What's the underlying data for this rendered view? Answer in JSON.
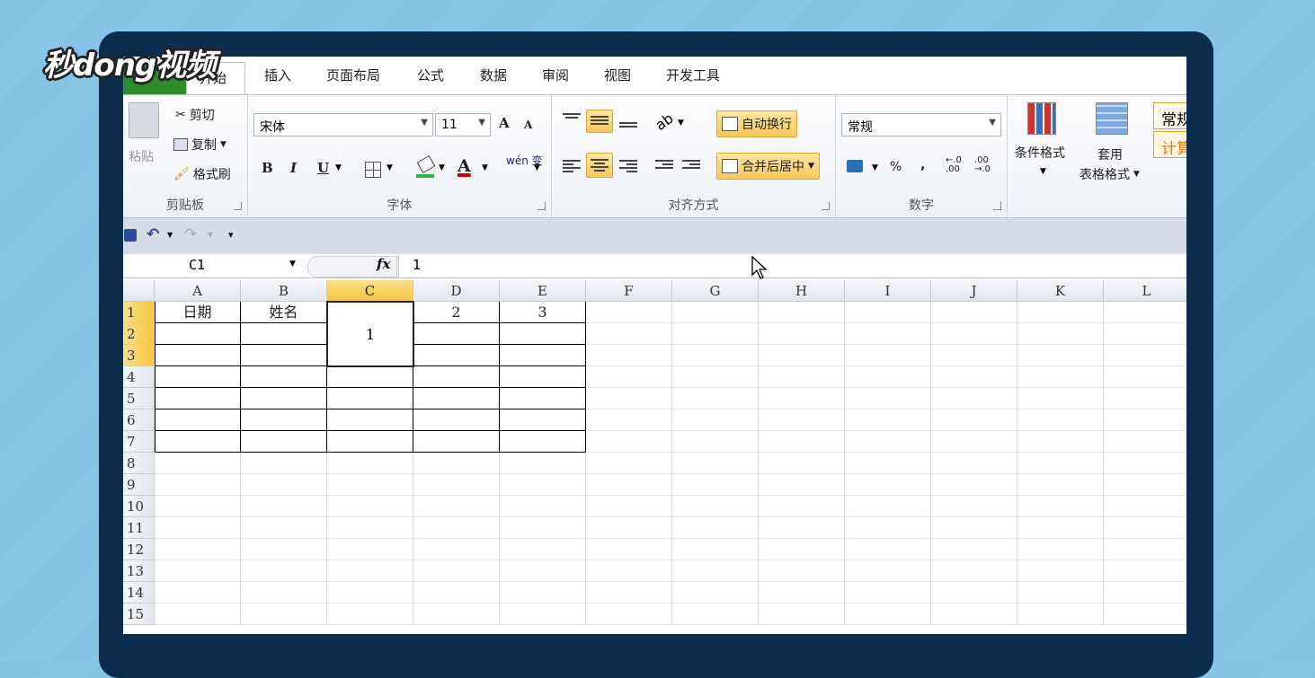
{
  "watermark": {
    "logo_text": "秒dong视频"
  },
  "tabs": [
    {
      "label": "开始",
      "active": true
    },
    {
      "label": "插入"
    },
    {
      "label": "页面布局"
    },
    {
      "label": "公式"
    },
    {
      "label": "数据"
    },
    {
      "label": "审阅"
    },
    {
      "label": "视图"
    },
    {
      "label": "开发工具"
    }
  ],
  "clipboard": {
    "paste": "粘贴",
    "cut": "剪切",
    "copy": "复制",
    "format_painter": "格式刷",
    "group_label": "剪贴板"
  },
  "font": {
    "font_name": "宋体",
    "font_size": "11",
    "bold": "B",
    "italic": "I",
    "underline": "U",
    "font_color": "A",
    "phonetic": "wén 变",
    "grow": "A",
    "shrink": "A",
    "group_label": "字体"
  },
  "alignment": {
    "wrap_text": "自动换行",
    "merge_center": "合并后居中",
    "group_label": "对齐方式"
  },
  "number": {
    "format": "常规",
    "percent": "%",
    "comma": ",",
    "inc_decimal": "←.0 .00",
    "dec_decimal": ".00 →.0",
    "group_label": "数字"
  },
  "styles": {
    "conditional": "条件格式",
    "table_format_1": "套用",
    "table_format_2": "表格格式",
    "style_normal": "常规",
    "style_calc": "计算"
  },
  "formula_bar": {
    "name_box": "C1",
    "fx": "fx",
    "value": "1"
  },
  "columns": [
    "A",
    "B",
    "C",
    "D",
    "E",
    "F",
    "G",
    "H",
    "I",
    "J",
    "K",
    "L"
  ],
  "selected_column": "C",
  "rows": [
    "1",
    "2",
    "3",
    "4",
    "5",
    "6",
    "7",
    "8",
    "9",
    "10",
    "11",
    "12",
    "13",
    "14",
    "15"
  ],
  "selected_rows": [
    "1",
    "2",
    "3"
  ],
  "cells": {
    "A1": "日期",
    "B1": "姓名",
    "C1_merged": "1",
    "D1": "2",
    "E1": "3"
  },
  "colors": {
    "accent_highlight": "#f8c85a",
    "frame": "#0c2e4c",
    "background": "#86c3e6"
  }
}
